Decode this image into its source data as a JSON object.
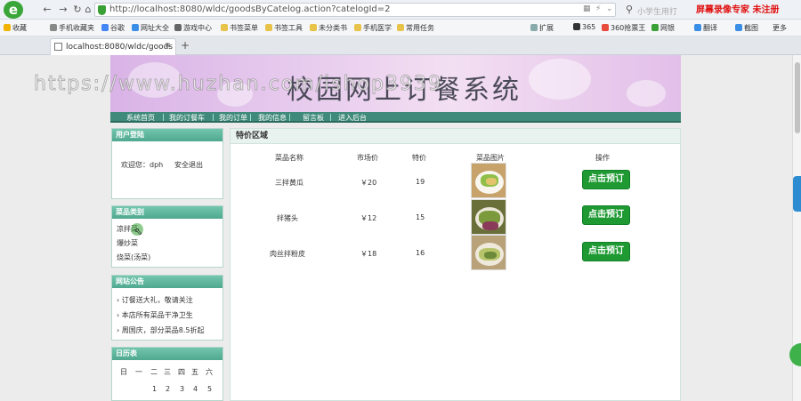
{
  "browser": {
    "url": "http://localhost:8080/wldc/goodsByCatelog.action?catelogId=2",
    "tab_title": "localhost:8080/wldc/goods",
    "search_hint": "小学生用打",
    "recording_label": "屏幕录像专家 未注册",
    "bookmarks": [
      "收藏",
      "手机收藏夹",
      "谷歌",
      "网址大全",
      "游戏中心",
      "书签菜单",
      "书签工具",
      "未分类书",
      "手机医学",
      "常用任务"
    ],
    "right_tools": [
      "扩展",
      "365",
      "360抢票王",
      "网银",
      "翻译",
      "截图",
      "更多"
    ]
  },
  "site": {
    "title": "校园网上订餐系统",
    "watermark": "https://www.huzhan.com/ishop3939",
    "menu": [
      "系统首页",
      "我的订餐车",
      "我的订单",
      "我的信息",
      "留言板",
      "进入后台"
    ]
  },
  "login_box": {
    "title": "用户登陆",
    "welcome": "欢迎您：dph",
    "logout": "安全退出"
  },
  "category_box": {
    "title": "菜品类别",
    "items": [
      "凉拌菜",
      "爆炒菜",
      "烧菜(汤菜)"
    ]
  },
  "notice_box": {
    "title": "网站公告",
    "items": [
      "订餐送大礼，敬请关注",
      "本店所有菜品干净卫生",
      "周国庆，部分菜品8.5折起"
    ]
  },
  "calendar_box": {
    "title": "日历表",
    "weekdays": [
      "日",
      "一",
      "二",
      "三",
      "四",
      "五",
      "六"
    ],
    "days": [
      "1",
      "2",
      "3",
      "4",
      "5"
    ]
  },
  "main": {
    "title": "特价区域",
    "headers": [
      "菜品名称",
      "市场价",
      "特价",
      "菜品图片",
      "操作"
    ],
    "rows": [
      {
        "name": "三拌黄瓜",
        "market_price": "￥20",
        "special_price": "19",
        "action": "点击预订"
      },
      {
        "name": "拌猪头",
        "market_price": "￥12",
        "special_price": "15",
        "action": "点击预订"
      },
      {
        "name": "肉丝拌粉皮",
        "market_price": "￥18",
        "special_price": "16",
        "action": "点击预订"
      }
    ]
  },
  "colors": {
    "menubar": "#3f8a7a",
    "box_header": "#4ea88f",
    "order_button": "#1f9a33",
    "banner": "#e2bfe9"
  }
}
